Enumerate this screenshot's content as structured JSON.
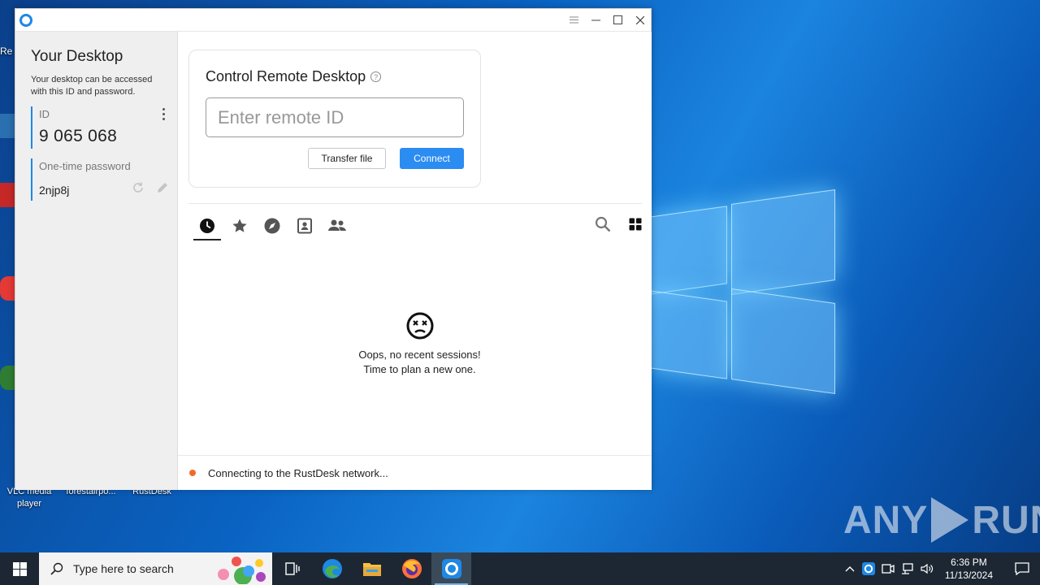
{
  "colors": {
    "accent": "#2b8cf2",
    "status_connecting": "#f06a2a",
    "taskbar": "#1c2733"
  },
  "desktop": {
    "icons": [
      {
        "label": "VLC media player",
        "icon": "vlc-icon"
      },
      {
        "label": "forestairpo...",
        "icon": "file-icon"
      },
      {
        "label": "RustDesk",
        "icon": "rustdesk-icon"
      }
    ],
    "partial_label": "Re",
    "watermark": {
      "left": "ANY",
      "right": "RUN"
    }
  },
  "window": {
    "title_icon": "rustdesk-logo-icon",
    "controls": [
      "menu-icon",
      "minimize-icon",
      "maximize-icon",
      "close-icon"
    ]
  },
  "sidebar": {
    "title": "Your Desktop",
    "description": "Your desktop can be accessed with this ID and password.",
    "id_label": "ID",
    "id_value": "9 065 068",
    "password_label": "One-time password",
    "password_value": "2njp8j"
  },
  "connect": {
    "title": "Control Remote Desktop",
    "help_icon": "?",
    "input_placeholder": "Enter remote ID",
    "transfer_button": "Transfer file",
    "connect_button": "Connect"
  },
  "tabs": [
    {
      "name": "recent",
      "icon": "clock-icon",
      "active": true
    },
    {
      "name": "favorites",
      "icon": "star-icon",
      "active": false
    },
    {
      "name": "discovered",
      "icon": "compass-icon",
      "active": false
    },
    {
      "name": "address-book",
      "icon": "contact-book-icon",
      "active": false
    },
    {
      "name": "group",
      "icon": "people-icon",
      "active": false
    }
  ],
  "empty_state": {
    "line1": "Oops, no recent sessions!",
    "line2": "Time to plan a new one."
  },
  "status": {
    "text": "Connecting to the RustDesk network..."
  },
  "taskbar": {
    "search_placeholder": "Type here to search",
    "apps": [
      "task-view-icon",
      "edge-icon",
      "file-explorer-icon",
      "firefox-icon",
      "rustdesk-icon"
    ],
    "time": "6:36 PM",
    "date": "11/13/2024"
  }
}
